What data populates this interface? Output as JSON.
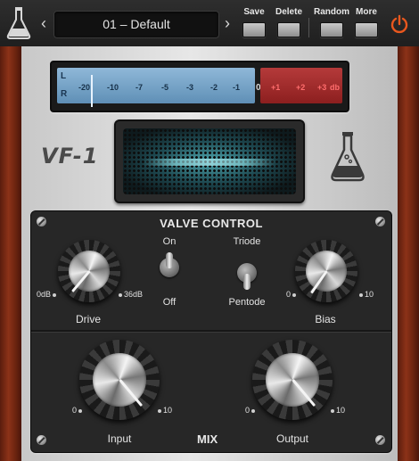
{
  "toolbar": {
    "prev_arrow": "‹",
    "next_arrow": "›",
    "preset_name": "01 – Default",
    "save_label": "Save",
    "delete_label": "Delete",
    "random_label": "Random",
    "more_label": "More",
    "power_color": "#e8571e"
  },
  "meter": {
    "channel_l": "L",
    "channel_r": "R",
    "ticks_blue": [
      "-20",
      "-10",
      "-7",
      "-5",
      "-3",
      "-2",
      "-1"
    ],
    "zero": "0",
    "ticks_red": [
      "+1",
      "+2",
      "+3",
      "db"
    ]
  },
  "brand": {
    "model": "VF-1"
  },
  "valve_control": {
    "title": "VALVE CONTROL",
    "drive": {
      "label": "Drive",
      "min": "0dB",
      "max": "36dB"
    },
    "mode_switch": {
      "top": "On",
      "bottom": "Off",
      "state": "top"
    },
    "tube_switch": {
      "top": "Triode",
      "bottom": "Pentode",
      "state": "bottom"
    },
    "bias": {
      "label": "Bias",
      "min": "0",
      "max": "10"
    }
  },
  "mix_section": {
    "title": "MIX",
    "input": {
      "label": "Input",
      "min": "0",
      "max": "10"
    },
    "output": {
      "label": "Output",
      "min": "0",
      "max": "10"
    }
  }
}
